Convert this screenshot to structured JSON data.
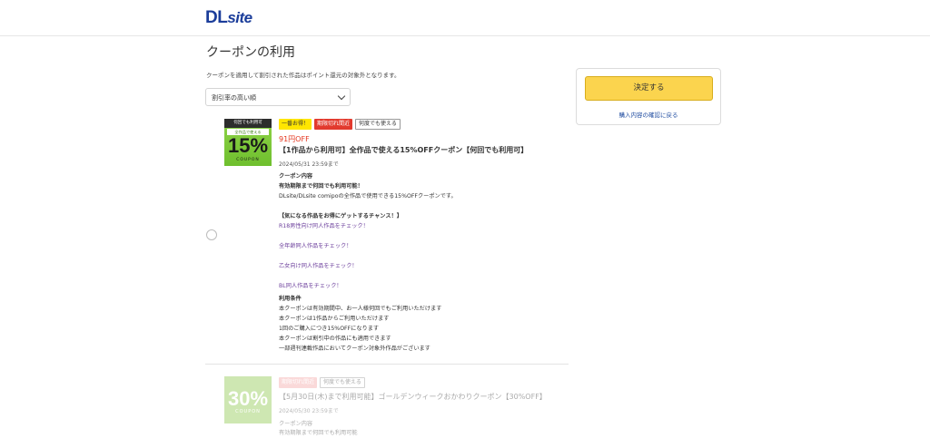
{
  "header": {
    "logo_main": "DL",
    "logo_tail": "site"
  },
  "page": {
    "title": "クーポンの利用",
    "notice": "クーポンを適用して割引された作品はポイント還元の対象外となります。"
  },
  "sort": {
    "selected": "割引率の高い順"
  },
  "sidebar": {
    "decide_button": "決定する",
    "back_link": "購入内容の確認に戻る"
  },
  "coupons": [
    {
      "thumb": {
        "band": "何回でも利用可",
        "sub": "全作品で使える",
        "percent": "15%",
        "off": "OFF",
        "coupon": "COUPON"
      },
      "badges": [
        "一番お得！",
        "期限切れ間近",
        "何度でも使える"
      ],
      "discount": "91円OFF",
      "title": "【1作品から利用可】全作品で使える15%OFFクーポン【何回でも利用可】",
      "expires": "2024/05/31 23:59まで",
      "details": {
        "heading": "クーポン内容",
        "line1": "有効期限まで何回でも利用可能！",
        "line2": "DLsite/DLsite comipoの全作品で使用できる15%OFFクーポンです。",
        "chance": "【気になる作品をお得にゲットするチャンス！】",
        "link1": "R18男性向け同人作品をチェック！",
        "link2": "全年齢同人作品をチェック！",
        "link3": "乙女向け同人作品をチェック！",
        "link4": "BL同人作品をチェック！",
        "terms_heading": "利用条件",
        "term1": "本クーポンは有効期間中、お一人様何回でもご利用いただけます",
        "term2": "本クーポンは1作品からご利用いただけます",
        "term3": "1回のご購入につき15%OFFになります",
        "term4": "本クーポンは割引中の作品にも適用できます",
        "term5": "一部週刊連載作品においてクーポン対象外作品がございます"
      }
    },
    {
      "thumb": {
        "percent": "30%",
        "off": "OFF",
        "coupon": "COUPON"
      },
      "badges": [
        "期限切れ間近",
        "何度でも使える"
      ],
      "title": "【5月30日(木)まで利用可能】ゴールデンウィークおかわりクーポン【30%OFF】",
      "expires": "2024/05/30 23:59まで",
      "details": {
        "heading": "クーポン内容",
        "line1": "有効期限まで何回でも利用可能"
      }
    }
  ]
}
